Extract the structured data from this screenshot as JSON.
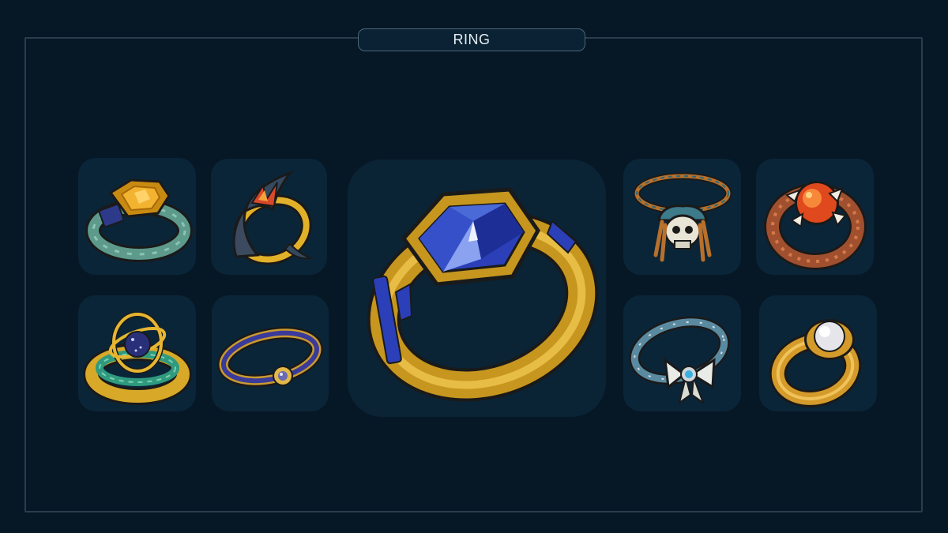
{
  "panel": {
    "title": "RING"
  },
  "items": [
    {
      "id": "tortoise-shell-ring",
      "icon": "tortoise-shell-ring-icon"
    },
    {
      "id": "flame-thorn-ring",
      "icon": "flame-thorn-ring-icon"
    },
    {
      "id": "sapphire-ring",
      "icon": "sapphire-ring-icon",
      "selected": true
    },
    {
      "id": "pirate-skull-ring",
      "icon": "pirate-skull-ring-icon"
    },
    {
      "id": "claw-fire-ring",
      "icon": "claw-fire-ring-icon"
    },
    {
      "id": "armillary-orb-ring",
      "icon": "armillary-orb-ring-icon"
    },
    {
      "id": "rune-band-ring",
      "icon": "rune-band-ring-icon"
    },
    {
      "id": "ribbon-bow-ring",
      "icon": "ribbon-bow-ring-icon"
    },
    {
      "id": "pearl-ring",
      "icon": "pearl-ring-icon"
    }
  ],
  "colors": {
    "background": "#061826",
    "slot": "#0b2538",
    "frame": "#2a3d4c",
    "gold": "#d4a21f",
    "sapphire": "#2b3fb8"
  }
}
